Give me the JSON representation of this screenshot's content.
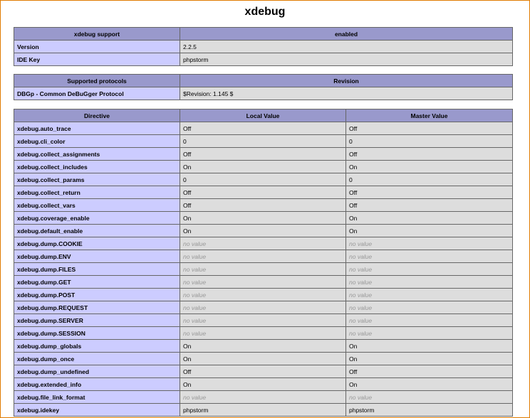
{
  "title": "xdebug",
  "support_table": {
    "header": [
      "xdebug support",
      "enabled"
    ],
    "rows": [
      {
        "label": "Version",
        "value": "2.2.5"
      },
      {
        "label": "IDE Key",
        "value": "phpstorm"
      }
    ]
  },
  "protocols_table": {
    "header": [
      "Supported protocols",
      "Revision"
    ],
    "rows": [
      {
        "label": "DBGp - Common DeBuGger Protocol",
        "value": "$Revision: 1.145 $"
      }
    ]
  },
  "directives_table": {
    "header": [
      "Directive",
      "Local Value",
      "Master Value"
    ],
    "rows": [
      {
        "name": "xdebug.auto_trace",
        "local": "Off",
        "master": "Off"
      },
      {
        "name": "xdebug.cli_color",
        "local": "0",
        "master": "0"
      },
      {
        "name": "xdebug.collect_assignments",
        "local": "Off",
        "master": "Off"
      },
      {
        "name": "xdebug.collect_includes",
        "local": "On",
        "master": "On"
      },
      {
        "name": "xdebug.collect_params",
        "local": "0",
        "master": "0"
      },
      {
        "name": "xdebug.collect_return",
        "local": "Off",
        "master": "Off"
      },
      {
        "name": "xdebug.collect_vars",
        "local": "Off",
        "master": "Off"
      },
      {
        "name": "xdebug.coverage_enable",
        "local": "On",
        "master": "On"
      },
      {
        "name": "xdebug.default_enable",
        "local": "On",
        "master": "On"
      },
      {
        "name": "xdebug.dump.COOKIE",
        "local": "no value",
        "master": "no value"
      },
      {
        "name": "xdebug.dump.ENV",
        "local": "no value",
        "master": "no value"
      },
      {
        "name": "xdebug.dump.FILES",
        "local": "no value",
        "master": "no value"
      },
      {
        "name": "xdebug.dump.GET",
        "local": "no value",
        "master": "no value"
      },
      {
        "name": "xdebug.dump.POST",
        "local": "no value",
        "master": "no value"
      },
      {
        "name": "xdebug.dump.REQUEST",
        "local": "no value",
        "master": "no value"
      },
      {
        "name": "xdebug.dump.SERVER",
        "local": "no value",
        "master": "no value"
      },
      {
        "name": "xdebug.dump.SESSION",
        "local": "no value",
        "master": "no value"
      },
      {
        "name": "xdebug.dump_globals",
        "local": "On",
        "master": "On"
      },
      {
        "name": "xdebug.dump_once",
        "local": "On",
        "master": "On"
      },
      {
        "name": "xdebug.dump_undefined",
        "local": "Off",
        "master": "Off"
      },
      {
        "name": "xdebug.extended_info",
        "local": "On",
        "master": "On"
      },
      {
        "name": "xdebug.file_link_format",
        "local": "no value",
        "master": "no value"
      },
      {
        "name": "xdebug.idekey",
        "local": "phpstorm",
        "master": "phpstorm"
      }
    ]
  },
  "colors": {
    "header_bg": "#9999cc",
    "label_bg": "#ccccff",
    "value_bg": "#dddddd",
    "no_value_text": "#999999",
    "frame_border": "#e07b00"
  },
  "no_value_text": "no value"
}
